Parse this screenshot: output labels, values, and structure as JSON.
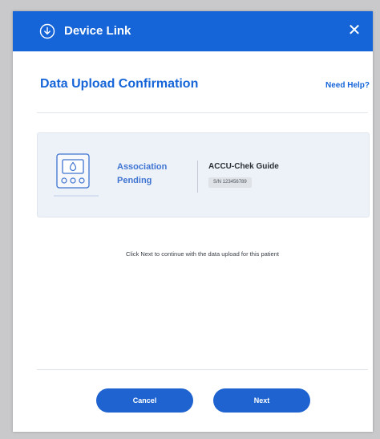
{
  "header": {
    "title": "Device Link",
    "close_label": "✕"
  },
  "page": {
    "title": "Data Upload Confirmation",
    "help_link": "Need Help?"
  },
  "device": {
    "status_line1": "Association",
    "status_line2": "Pending",
    "name": "ACCU-Chek Guide",
    "serial": "S/N 123456789",
    "icon": "glucose-meter-icon"
  },
  "instruction": "Click Next to continue with the data upload for this patient",
  "buttons": {
    "cancel": "Cancel",
    "next": "Next"
  },
  "colors": {
    "header": "#1565d8",
    "accent": "#1565d8",
    "button": "#1e63d0",
    "card_bg": "#edf2f9"
  }
}
